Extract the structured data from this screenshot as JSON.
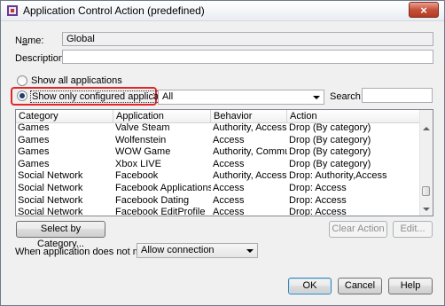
{
  "window": {
    "title": "Application Control Action (predefined)",
    "close_glyph": "×",
    "icon": "app-shield-icon"
  },
  "form": {
    "name_label_prefix": "N",
    "name_label_underlined": "a",
    "name_label_suffix": "me:",
    "name_value": "Global",
    "description_label": "Description:",
    "description_value": ""
  },
  "options": {
    "show_all_label": "Show all applications",
    "show_configured_label": "Show only configured applications",
    "filter_colon": ":",
    "category_filter_value": "All",
    "search_label": "Search:",
    "search_value": ""
  },
  "table": {
    "columns": [
      "Category",
      "Application",
      "Behavior",
      "Action"
    ],
    "rows": [
      [
        "Games",
        "Valve Steam",
        "Authority, Access",
        "Drop (By category)"
      ],
      [
        "Games",
        "Wolfenstein",
        "Access",
        "Drop (By category)"
      ],
      [
        "Games",
        "WOW Game",
        "Authority, Communi...",
        "Drop (By category)"
      ],
      [
        "Games",
        "Xbox LIVE",
        "Access",
        "Drop (By category)"
      ],
      [
        "Social Network",
        "Facebook",
        "Authority, Access",
        "Drop: Authority,Access"
      ],
      [
        "Social Network",
        "Facebook Applications",
        "Access",
        "Drop: Access"
      ],
      [
        "Social Network",
        "Facebook Dating",
        "Access",
        "Drop: Access"
      ],
      [
        "Social Network",
        "Facebook EditProfile",
        "Access",
        "Drop: Access"
      ]
    ]
  },
  "buttons": {
    "select_by_category": "Select by Category...",
    "clear_action": "Clear Action",
    "edit": "Edit...",
    "ok": "OK",
    "cancel": "Cancel",
    "help": "Help"
  },
  "nomatch": {
    "label": "When application does not match:",
    "value": "Allow connection"
  }
}
